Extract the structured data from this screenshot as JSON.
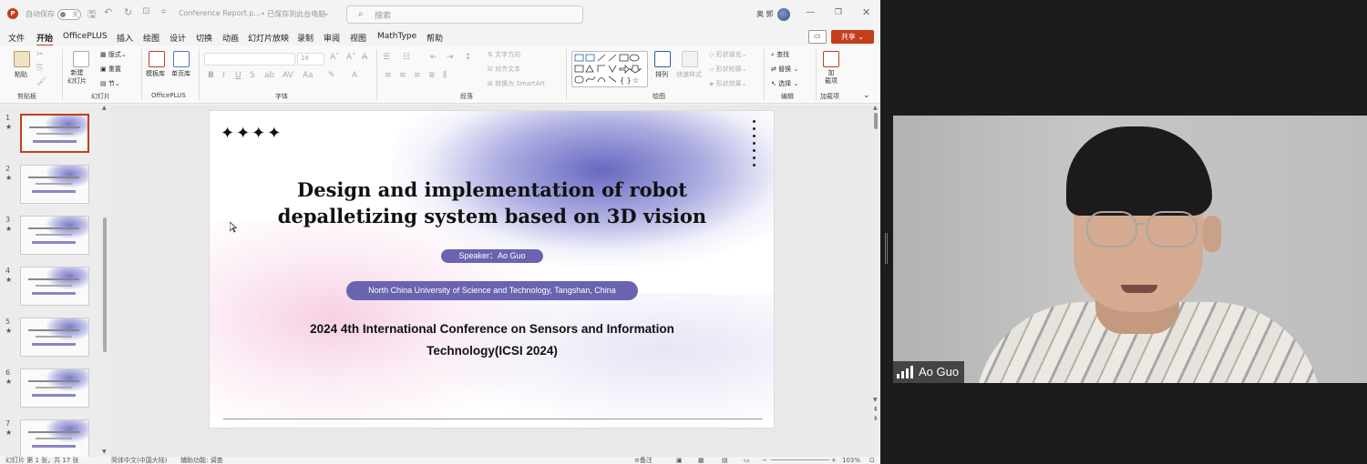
{
  "window": {
    "autosave_label": "自动保存",
    "autosave_state": "关",
    "document_title": "Conference Report.p...",
    "save_status": "• 已保存到此台电脑",
    "search_placeholder": "搜索",
    "user_name": "奥 郭"
  },
  "menu": {
    "tabs": [
      "文件",
      "开始",
      "OfficePLUS",
      "插入",
      "绘图",
      "设计",
      "切换",
      "动画",
      "幻灯片放映",
      "录制",
      "审阅",
      "视图",
      "MathType",
      "帮助"
    ],
    "active_tab": "开始",
    "share_label": "共享"
  },
  "ribbon": {
    "groups": {
      "clipboard": "剪贴板",
      "slides": "幻灯片",
      "officeplus": "OfficePLUS",
      "font": "字体",
      "paragraph": "段落",
      "drawing": "绘图",
      "editing": "编辑",
      "addins": "加载项"
    },
    "paste": "粘贴",
    "new_slide": "新建\n幻灯片",
    "layout": "版式",
    "reset": "重置",
    "section": "节",
    "template_lib": "模板库",
    "single_page": "单页库",
    "font_size": "18",
    "text_direction": "文字方向",
    "align_text": "对齐文本",
    "convert_smartart": "转换为 SmartArt",
    "arrange": "排列",
    "quick_styles": "快速样式",
    "shape_fill": "形状填充",
    "shape_outline": "形状轮廓",
    "shape_effects": "形状效果",
    "find": "查找",
    "replace": "替换",
    "select": "选择",
    "addin_label": "加\n载项"
  },
  "thumbnails": [
    {
      "num": "1",
      "selected": true
    },
    {
      "num": "2",
      "selected": false
    },
    {
      "num": "3",
      "selected": false
    },
    {
      "num": "4",
      "selected": false
    },
    {
      "num": "5",
      "selected": false
    },
    {
      "num": "6",
      "selected": false
    },
    {
      "num": "7",
      "selected": false
    }
  ],
  "slide": {
    "title": "Design and implementation of robot depalletizing system based on 3D vision",
    "speaker": "Speaker：Ao Guo",
    "affiliation": "North China University of Science and Technology, Tangshan, China",
    "conference": "2024 4th International Conference on Sensors and Information Technology(ICSI  2024)",
    "stars": "✦✦✦✦"
  },
  "status": {
    "slide_info": "幻灯片 第 1 张，共 17 张",
    "language": "简体中文(中国大陆)",
    "accessibility": "辅助功能: 调查",
    "notes": "备注",
    "zoom": "103%"
  },
  "video": {
    "participant_name": "Ao Guo"
  },
  "colors": {
    "accent": "#c43e1c",
    "pill": "#6a64b0"
  }
}
